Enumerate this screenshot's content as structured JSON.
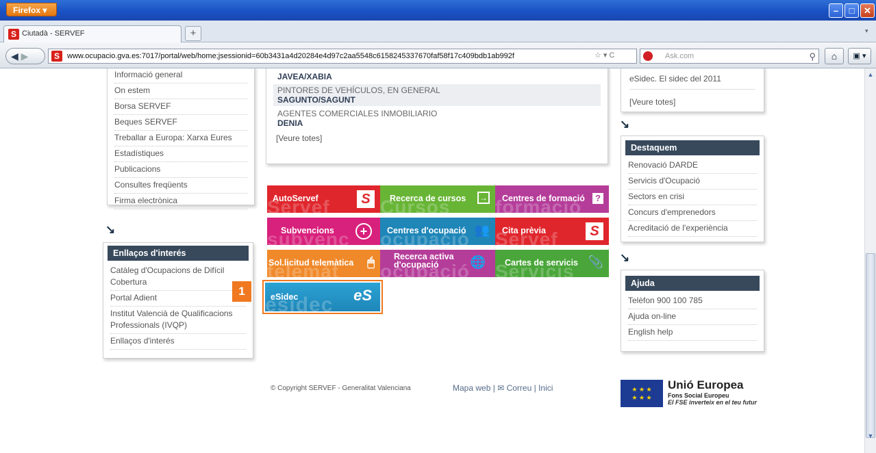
{
  "browser": {
    "menu_button": "Firefox ▾",
    "tab_title": "Ciutadà - SERVEF",
    "new_tab": "+",
    "url": "www.ocupacio.gva.es:7017/portal/web/home;jsessionid=60b3431a4d20284e4d97c2aa5548c6158245337670faf58f17c409bdb1ab992f",
    "search_placeholder": "Ask.com",
    "favicon_letter": "S"
  },
  "left_menu": {
    "items": [
      "Informació general",
      "On estem",
      "Borsa SERVEF",
      "Beques SERVEF",
      "Treballar a Europa: Xarxa Eures",
      "Estadístiques",
      "Publicacions",
      "Consultes freqüents",
      "Firma electrònica"
    ]
  },
  "links_box": {
    "title": "Enllaços d'interés",
    "items": [
      "Catàleg d'Ocupacions de Difícil Cobertura",
      "Portal Adient",
      "Institut Valencià de Qualificacions Professionals (IVQP)",
      "Enllaços d'interés"
    ]
  },
  "offers": {
    "first_city": "JAVEA/XABIA",
    "jobs": [
      {
        "title": "PINTORES DE VEHÍCULOS, EN GENERAL",
        "city": "SAGUNTO/SAGUNT"
      },
      {
        "title": "AGENTES COMERCIALES INMOBILIARIO",
        "city": "DENIA"
      }
    ],
    "see_all": "[Veure totes]"
  },
  "tiles": [
    {
      "label": "AutoServef",
      "wm": "Servef",
      "color": "#e0262d"
    },
    {
      "label": "Recerca de cursos",
      "wm": "Cursos",
      "color": "#68b536"
    },
    {
      "label": "Centres de formació",
      "wm": "formació",
      "color": "#b53d9a"
    },
    {
      "label": "Subvencions",
      "wm": "subvenc",
      "color": "#d8217c"
    },
    {
      "label": "Centres d'ocupació",
      "wm": "ocupació",
      "color": "#1f86b8"
    },
    {
      "label": "Cita prèvia",
      "wm": "Servef",
      "color": "#e0262d"
    },
    {
      "label": "Sol.licitud telemàtica",
      "wm": "telemàt",
      "color": "#f0892a"
    },
    {
      "label": "Recerca activa d'ocupació",
      "wm": "ocupació",
      "color": "#b53d9a"
    },
    {
      "label": "Cartes de servicis",
      "wm": "Servicis",
      "color": "#4aa63a"
    }
  ],
  "esidec_tile": {
    "label": "eSidec",
    "wm": "esidec",
    "logo": "eS",
    "color": "#1f86b8"
  },
  "step_marker": "1",
  "news": {
    "item": "eSidec. El sidec del 2011",
    "see_all": "[Veure totes]"
  },
  "highlights": {
    "title": "Destaquem",
    "items": [
      "Renovació DARDE",
      "Servicis d'Ocupació",
      "Sectors en crisi",
      "Concurs d'emprenedors",
      "Acreditació de l'experiència"
    ]
  },
  "help": {
    "title": "Ajuda",
    "items": [
      "Telèfon 900 100 785",
      "Ajuda on-line",
      "English help"
    ]
  },
  "footer": {
    "copyright": "© Copyright SERVEF - Generalitat Valenciana",
    "sitemap": "Mapa web",
    "mail": "Correu",
    "home": "Inici",
    "sep": "|",
    "eu_title": "Unió Europea",
    "eu_sub": "Fons Social Europeu",
    "eu_motto": "El FSE inverteix en el teu futur"
  }
}
